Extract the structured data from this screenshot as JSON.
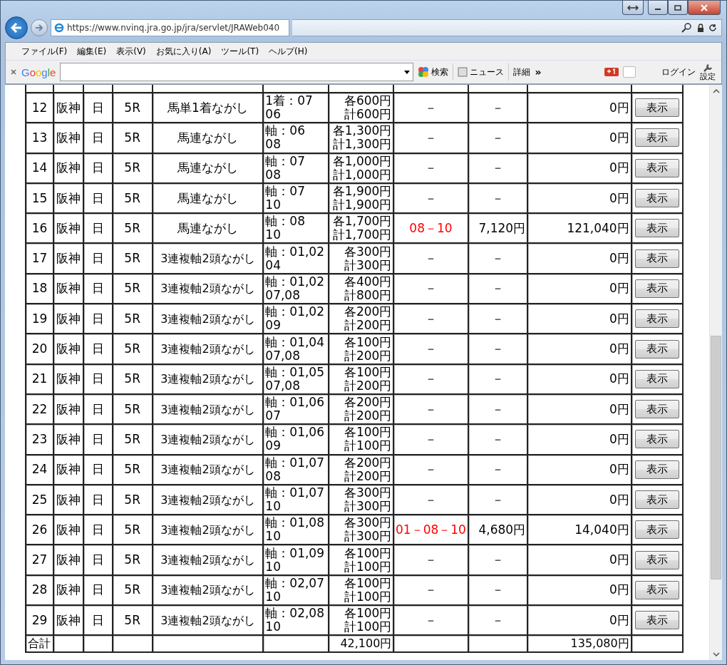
{
  "browser": {
    "url": "https://www.nvinq.jra.go.jp/jra/servlet/JRAWeb040",
    "menu": [
      "ファイル(F)",
      "編集(E)",
      "表示(V)",
      "お気に入り(A)",
      "ツール(T)",
      "ヘルプ(H)"
    ],
    "toolbar": {
      "logo": "Google",
      "search": "検索",
      "news": "ニュース",
      "details": "詳細",
      "more": "»",
      "login": "ログイン",
      "settings": "設定"
    }
  },
  "table": {
    "rows": [
      {
        "no": "12",
        "venue": "阪神",
        "day": "日",
        "race": "5R",
        "type": "馬単1着ながし",
        "bet": [
          "1着：07",
          "06"
        ],
        "amount": [
          "各600円",
          "計600円"
        ],
        "result": "－",
        "odds": "－",
        "payout": "0円",
        "hit": false,
        "button": "表示"
      },
      {
        "no": "13",
        "venue": "阪神",
        "day": "日",
        "race": "5R",
        "type": "馬連ながし",
        "bet": [
          "軸：06",
          "08"
        ],
        "amount": [
          "各1,300円",
          "計1,300円"
        ],
        "result": "－",
        "odds": "－",
        "payout": "0円",
        "hit": false,
        "button": "表示"
      },
      {
        "no": "14",
        "venue": "阪神",
        "day": "日",
        "race": "5R",
        "type": "馬連ながし",
        "bet": [
          "軸：07",
          "08"
        ],
        "amount": [
          "各1,000円",
          "計1,000円"
        ],
        "result": "－",
        "odds": "－",
        "payout": "0円",
        "hit": false,
        "button": "表示"
      },
      {
        "no": "15",
        "venue": "阪神",
        "day": "日",
        "race": "5R",
        "type": "馬連ながし",
        "bet": [
          "軸：07",
          "10"
        ],
        "amount": [
          "各1,900円",
          "計1,900円"
        ],
        "result": "－",
        "odds": "－",
        "payout": "0円",
        "hit": false,
        "button": "表示"
      },
      {
        "no": "16",
        "venue": "阪神",
        "day": "日",
        "race": "5R",
        "type": "馬連ながし",
        "bet": [
          "軸：08",
          "10"
        ],
        "amount": [
          "各1,700円",
          "計1,700円"
        ],
        "result": "08－10",
        "odds": "7,120円",
        "payout": "121,040円",
        "hit": true,
        "button": "表示"
      },
      {
        "no": "17",
        "venue": "阪神",
        "day": "日",
        "race": "5R",
        "type": "3連複軸2頭ながし",
        "bet": [
          "軸：01,02",
          "04"
        ],
        "amount": [
          "各300円",
          "計300円"
        ],
        "result": "－",
        "odds": "－",
        "payout": "0円",
        "hit": false,
        "button": "表示"
      },
      {
        "no": "18",
        "venue": "阪神",
        "day": "日",
        "race": "5R",
        "type": "3連複軸2頭ながし",
        "bet": [
          "軸：01,02",
          "07,08"
        ],
        "amount": [
          "各400円",
          "計800円"
        ],
        "result": "－",
        "odds": "－",
        "payout": "0円",
        "hit": false,
        "button": "表示"
      },
      {
        "no": "19",
        "venue": "阪神",
        "day": "日",
        "race": "5R",
        "type": "3連複軸2頭ながし",
        "bet": [
          "軸：01,02",
          "09"
        ],
        "amount": [
          "各200円",
          "計200円"
        ],
        "result": "－",
        "odds": "－",
        "payout": "0円",
        "hit": false,
        "button": "表示"
      },
      {
        "no": "20",
        "venue": "阪神",
        "day": "日",
        "race": "5R",
        "type": "3連複軸2頭ながし",
        "bet": [
          "軸：01,04",
          "07,08"
        ],
        "amount": [
          "各100円",
          "計200円"
        ],
        "result": "－",
        "odds": "－",
        "payout": "0円",
        "hit": false,
        "button": "表示"
      },
      {
        "no": "21",
        "venue": "阪神",
        "day": "日",
        "race": "5R",
        "type": "3連複軸2頭ながし",
        "bet": [
          "軸：01,05",
          "07,08"
        ],
        "amount": [
          "各100円",
          "計200円"
        ],
        "result": "－",
        "odds": "－",
        "payout": "0円",
        "hit": false,
        "button": "表示"
      },
      {
        "no": "22",
        "venue": "阪神",
        "day": "日",
        "race": "5R",
        "type": "3連複軸2頭ながし",
        "bet": [
          "軸：01,06",
          "07"
        ],
        "amount": [
          "各200円",
          "計200円"
        ],
        "result": "－",
        "odds": "－",
        "payout": "0円",
        "hit": false,
        "button": "表示"
      },
      {
        "no": "23",
        "venue": "阪神",
        "day": "日",
        "race": "5R",
        "type": "3連複軸2頭ながし",
        "bet": [
          "軸：01,06",
          "09"
        ],
        "amount": [
          "各100円",
          "計100円"
        ],
        "result": "－",
        "odds": "－",
        "payout": "0円",
        "hit": false,
        "button": "表示"
      },
      {
        "no": "24",
        "venue": "阪神",
        "day": "日",
        "race": "5R",
        "type": "3連複軸2頭ながし",
        "bet": [
          "軸：01,07",
          "08"
        ],
        "amount": [
          "各200円",
          "計200円"
        ],
        "result": "－",
        "odds": "－",
        "payout": "0円",
        "hit": false,
        "button": "表示"
      },
      {
        "no": "25",
        "venue": "阪神",
        "day": "日",
        "race": "5R",
        "type": "3連複軸2頭ながし",
        "bet": [
          "軸：01,07",
          "10"
        ],
        "amount": [
          "各300円",
          "計300円"
        ],
        "result": "－",
        "odds": "－",
        "payout": "0円",
        "hit": false,
        "button": "表示"
      },
      {
        "no": "26",
        "venue": "阪神",
        "day": "日",
        "race": "5R",
        "type": "3連複軸2頭ながし",
        "bet": [
          "軸：01,08",
          "10"
        ],
        "amount": [
          "各300円",
          "計300円"
        ],
        "result": "01－08－10",
        "odds": "4,680円",
        "payout": "14,040円",
        "hit": true,
        "button": "表示"
      },
      {
        "no": "27",
        "venue": "阪神",
        "day": "日",
        "race": "5R",
        "type": "3連複軸2頭ながし",
        "bet": [
          "軸：01,09",
          "10"
        ],
        "amount": [
          "各100円",
          "計100円"
        ],
        "result": "－",
        "odds": "－",
        "payout": "0円",
        "hit": false,
        "button": "表示"
      },
      {
        "no": "28",
        "venue": "阪神",
        "day": "日",
        "race": "5R",
        "type": "3連複軸2頭ながし",
        "bet": [
          "軸：02,07",
          "10"
        ],
        "amount": [
          "各100円",
          "計100円"
        ],
        "result": "－",
        "odds": "－",
        "payout": "0円",
        "hit": false,
        "button": "表示"
      },
      {
        "no": "29",
        "venue": "阪神",
        "day": "日",
        "race": "5R",
        "type": "3連複軸2頭ながし",
        "bet": [
          "軸：02,08",
          "10"
        ],
        "amount": [
          "各100円",
          "計100円"
        ],
        "result": "－",
        "odds": "－",
        "payout": "0円",
        "hit": false,
        "button": "表示"
      }
    ],
    "total": {
      "label": "合計",
      "amount": "42,100円",
      "payout": "135,080円"
    }
  }
}
